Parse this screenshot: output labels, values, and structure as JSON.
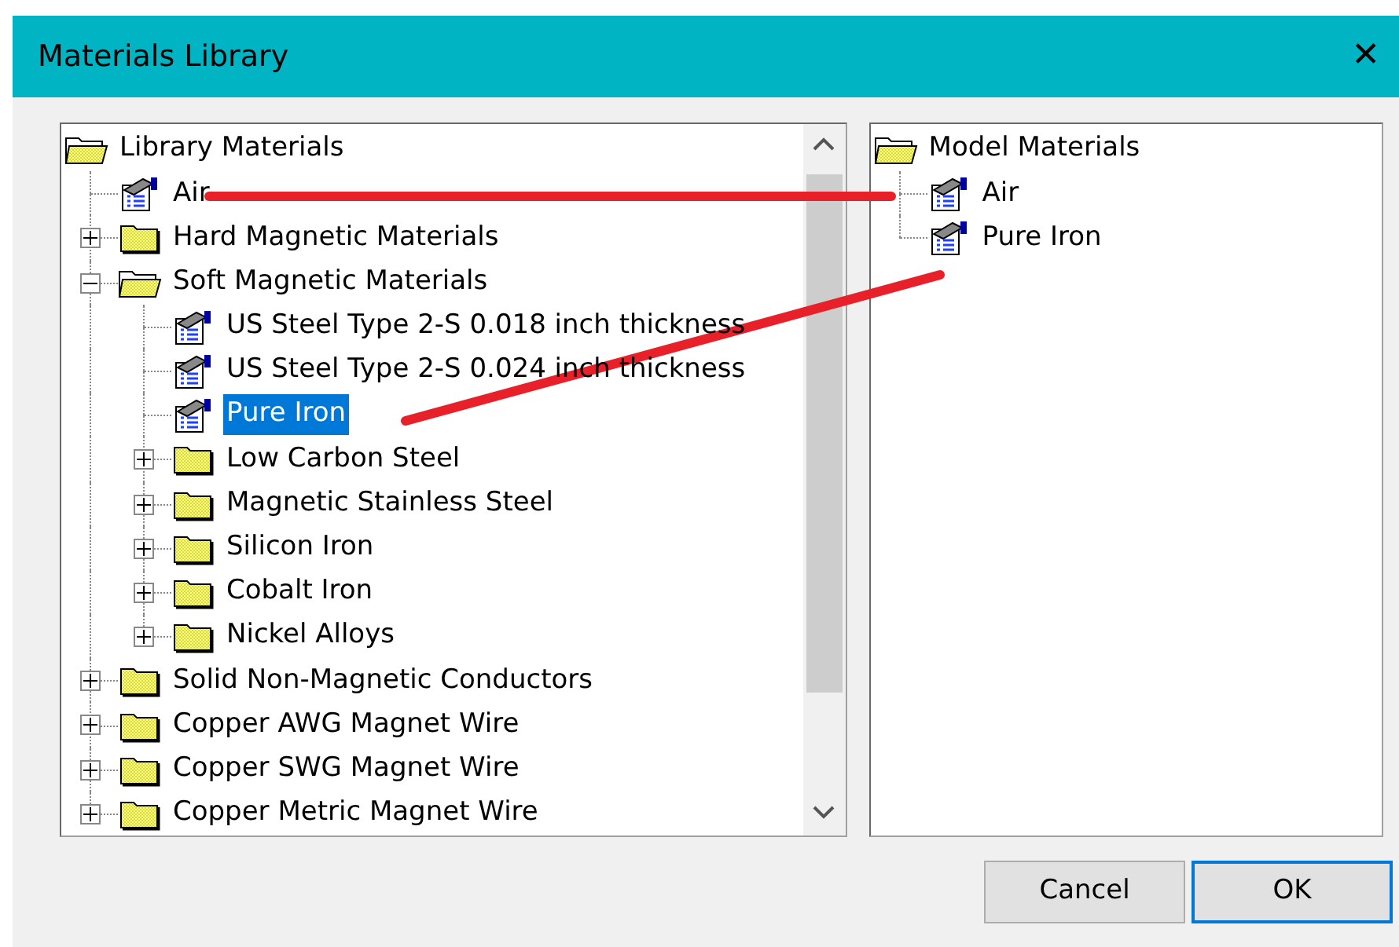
{
  "window": {
    "title": "Materials Library",
    "close": "✕"
  },
  "library_tree": [
    {
      "label": "Library Materials",
      "kind": "folder",
      "expanded": true,
      "selected": false,
      "children": [
        {
          "label": "Air",
          "kind": "material",
          "selected": false
        },
        {
          "label": "Hard Magnetic Materials",
          "kind": "folder",
          "expanded": false,
          "selected": false
        },
        {
          "label": "Soft Magnetic Materials",
          "kind": "folder",
          "expanded": true,
          "selected": false,
          "children": [
            {
              "label": "US Steel Type 2-S 0.018 inch thickness",
              "kind": "material",
              "selected": false
            },
            {
              "label": "US Steel Type 2-S 0.024 inch thickness",
              "kind": "material",
              "selected": false
            },
            {
              "label": "Pure Iron",
              "kind": "material",
              "selected": true
            },
            {
              "label": "Low Carbon Steel",
              "kind": "folder",
              "expanded": false,
              "selected": false
            },
            {
              "label": "Magnetic Stainless Steel",
              "kind": "folder",
              "expanded": false,
              "selected": false
            },
            {
              "label": "Silicon Iron",
              "kind": "folder",
              "expanded": false,
              "selected": false
            },
            {
              "label": "Cobalt Iron",
              "kind": "folder",
              "expanded": false,
              "selected": false
            },
            {
              "label": "Nickel Alloys",
              "kind": "folder",
              "expanded": false,
              "selected": false
            }
          ]
        },
        {
          "label": "Solid Non-Magnetic Conductors",
          "kind": "folder",
          "expanded": false,
          "selected": false
        },
        {
          "label": "Copper AWG Magnet Wire",
          "kind": "folder",
          "expanded": false,
          "selected": false
        },
        {
          "label": "Copper SWG Magnet Wire",
          "kind": "folder",
          "expanded": false,
          "selected": false
        },
        {
          "label": "Copper Metric Magnet Wire",
          "kind": "folder",
          "expanded": false,
          "selected": false
        }
      ]
    }
  ],
  "model_tree": [
    {
      "label": "Model Materials",
      "kind": "folder",
      "expanded": true,
      "selected": false,
      "children": [
        {
          "label": "Air",
          "kind": "material",
          "selected": false
        },
        {
          "label": "Pure Iron",
          "kind": "material",
          "selected": false
        }
      ]
    }
  ],
  "annotations": [
    {
      "kind": "stroke",
      "color": "#e8202a"
    },
    {
      "kind": "stroke",
      "color": "#e8202a"
    }
  ],
  "buttons": [
    {
      "label": "Cancel",
      "default": false
    },
    {
      "label": "OK",
      "default": true
    }
  ]
}
